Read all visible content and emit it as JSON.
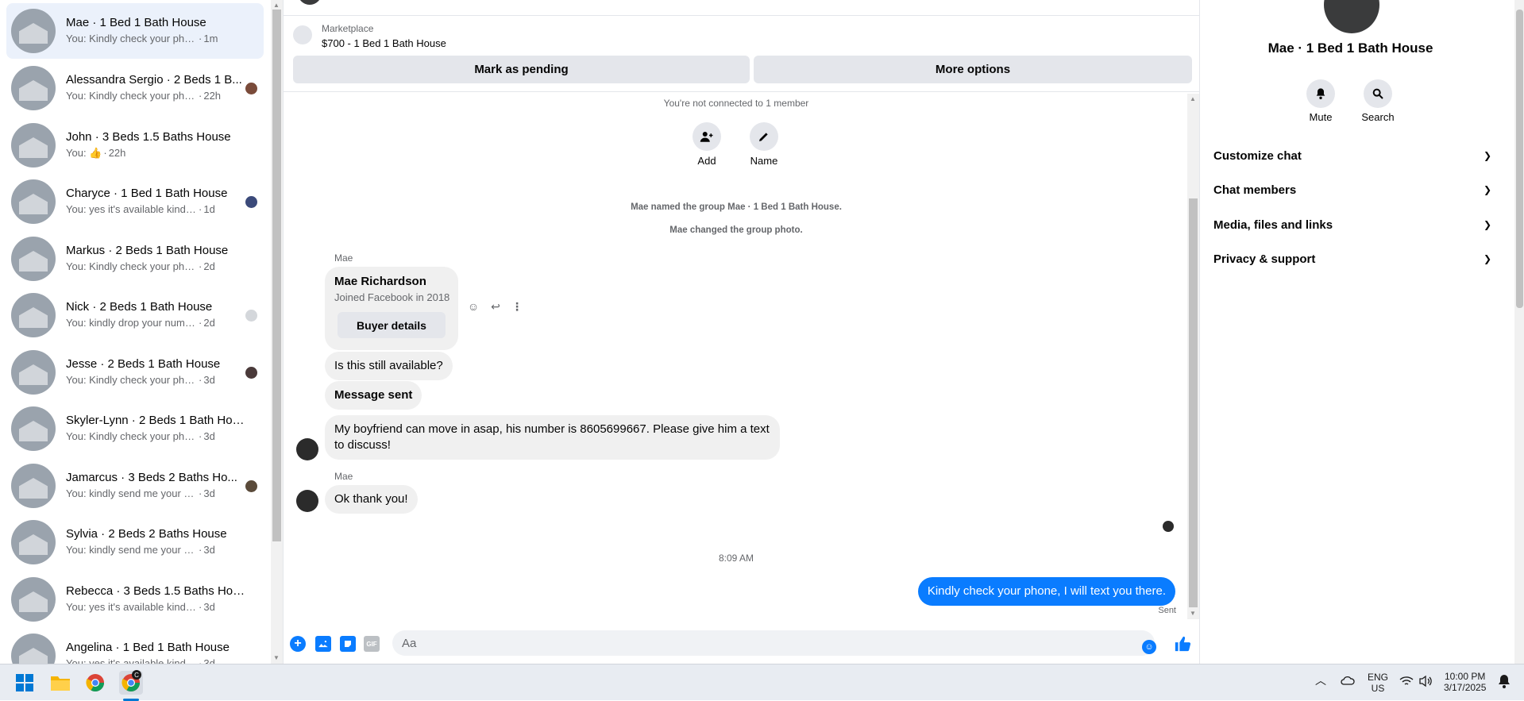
{
  "conversations": [
    {
      "name": "Mae · 1 Bed 1 Bath House",
      "snippet": "You: Kindly check your phone, I wi...",
      "time": "1m",
      "active": true
    },
    {
      "name": "Alessandra Sergio · 2 Beds 1 B...",
      "snippet": "You: Kindly check your phone, I...",
      "time": "22h"
    },
    {
      "name": "John · 3 Beds 1.5 Baths House",
      "snippet": "You: 👍",
      "time": "22h"
    },
    {
      "name": "Charyce · 1 Bed 1 Bath House",
      "snippet": "You: yes it's available kindly dro...",
      "time": "1d"
    },
    {
      "name": "Markus · 2 Beds 1 Bath House",
      "snippet": "You: Kindly check your phone, I will...",
      "time": "2d"
    },
    {
      "name": "Nick · 2 Beds 1 Bath House",
      "snippet": "You: kindly drop your number f...",
      "time": "2d"
    },
    {
      "name": "Jesse · 2 Beds 1 Bath House",
      "snippet": "You: Kindly check your phone, I ...",
      "time": "3d"
    },
    {
      "name": "Skyler-Lynn · 2 Beds 1 Bath House",
      "snippet": "You: Kindly check your phone, I will...",
      "time": "3d"
    },
    {
      "name": "Jamarcus · 3 Beds 2 Baths Ho...",
      "snippet": "You: kindly send me your numb...",
      "time": "3d"
    },
    {
      "name": "Sylvia · 2 Beds 2 Baths House",
      "snippet": "You: kindly send me your number f...",
      "time": "3d"
    },
    {
      "name": "Rebecca · 3 Beds 1.5 Baths House",
      "snippet": "You: yes it's available kindly drop y...",
      "time": "3d"
    },
    {
      "name": "Angelina · 1 Bed 1 Bath House",
      "snippet": "You: yes it's available kindly drop y...",
      "time": "3d"
    }
  ],
  "listing": {
    "label": "Marketplace",
    "price_title": "$700 - 1 Bed 1 Bath House",
    "mark_pending": "Mark as pending",
    "more_options": "More options"
  },
  "chat": {
    "not_connected": "You're not connected to 1 member",
    "add_label": "Add",
    "name_label": "Name",
    "sys_named": "Mae named the group Mae · 1 Bed 1 Bath House.",
    "sys_photo": "Mae changed the group photo.",
    "sender_1": "Mae",
    "card_name": "Mae Richardson",
    "card_sub": "Joined Facebook in 2018",
    "card_button": "Buyer details",
    "msg_available": "Is this still available?",
    "msg_sent": "Message sent",
    "msg_boyfriend": "My boyfriend can move in asap, his number is 8605699667. Please give him a text to discuss!",
    "sender_2": "Mae",
    "msg_thanks": "Ok thank you!",
    "timestamp": "8:09 AM",
    "msg_mine": "Kindly check your phone, I will text you there.",
    "sent_status": "Sent",
    "input_placeholder": "Aa",
    "gif_label": "GIF"
  },
  "details": {
    "title": "Mae · 1 Bed 1 Bath House",
    "mute_label": "Mute",
    "search_label": "Search",
    "sections": [
      "Customize chat",
      "Chat members",
      "Media, files and links",
      "Privacy & support"
    ]
  },
  "taskbar": {
    "lang_top": "ENG",
    "lang_bottom": "US",
    "time": "10:00 PM",
    "date": "3/17/2025",
    "chrome_badge": "C"
  },
  "colors": {
    "accent": "#0a7cff",
    "active_row": "#ebf1fb",
    "muted_text": "#65676b"
  }
}
